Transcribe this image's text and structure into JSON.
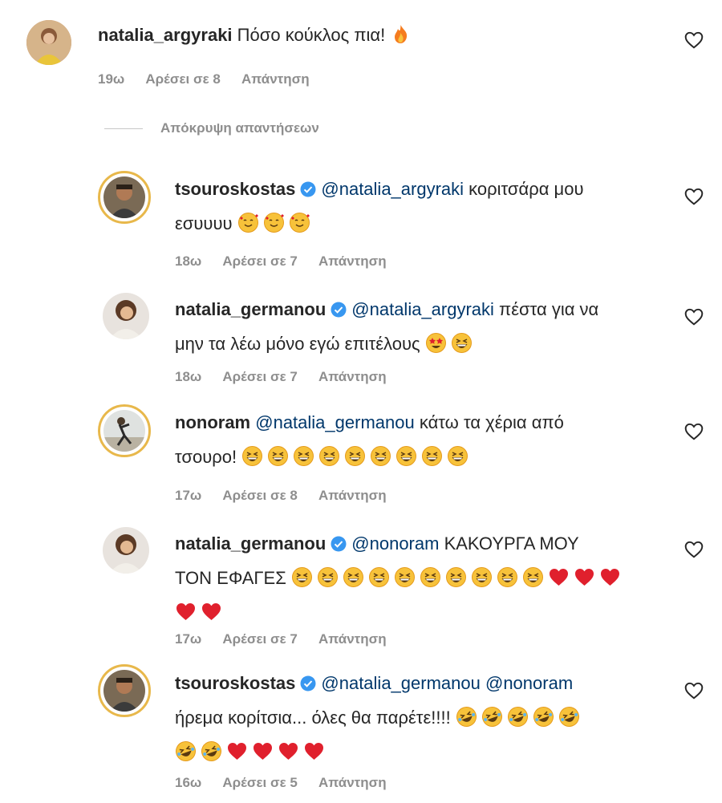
{
  "comments": [
    {
      "username": "natalia_argyraki",
      "verified": false,
      "mentions": [],
      "text_line1": "Πόσο κούκλος πια!",
      "text_line2": "",
      "time": "19ω",
      "likes": "Αρέσει σε 8",
      "reply": "Απάντηση",
      "emoji_line1": [
        "fire"
      ],
      "emoji_line2": [],
      "emoji_line3": []
    },
    {
      "username": "tsouroskostas",
      "verified": true,
      "mention1": "@natalia_argyraki",
      "text_line1": " κοριτσάρα μου",
      "text_line2": "εσυυυυ",
      "time": "18ω",
      "likes": "Αρέσει σε 7",
      "reply": "Απάντηση",
      "emoji_line2": [
        "smiling-hearts",
        "smiling-hearts",
        "smiling-hearts"
      ]
    },
    {
      "username": "natalia_germanou",
      "verified": true,
      "mention1": "@natalia_argyraki",
      "text_line1": " πέστα για να",
      "text_line2": "μην τα λέω μόνο εγώ επιτέλους",
      "time": "18ω",
      "likes": "Αρέσει σε 7",
      "reply": "Απάντηση",
      "emoji_line2": [
        "star-eyes",
        "grin"
      ]
    },
    {
      "username": "nonoram",
      "verified": false,
      "mention1": "@natalia_germanou",
      "text_line1": " κάτω τα χέρια από",
      "text_line2": "τσουρο!",
      "time": "17ω",
      "likes": "Αρέσει σε 8",
      "reply": "Απάντηση",
      "emoji_line2": [
        "grin",
        "grin",
        "grin",
        "grin",
        "grin",
        "grin",
        "grin",
        "grin",
        "grin"
      ]
    },
    {
      "username": "natalia_germanou",
      "verified": true,
      "mention1": "@nonoram",
      "text_line1": " ΚΑΚΟΥΡΓΑ ΜΟΥ",
      "text_line2": "ΤΟΝ ΕΦΑΓΕΣ",
      "time": "17ω",
      "likes": "Αρέσει σε 7",
      "reply": "Απάντηση",
      "emoji_line2": [
        "grin",
        "grin",
        "grin",
        "grin",
        "grin",
        "grin",
        "grin",
        "grin",
        "grin",
        "grin",
        "heart",
        "heart",
        "heart"
      ],
      "emoji_line3": [
        "heart",
        "heart"
      ]
    },
    {
      "username": "tsouroskostas",
      "verified": true,
      "mention1": "@natalia_germanou",
      "mention2": "@nonoram",
      "text_line1": " ",
      "text_line2": "ήρεμα κορίτσια... όλες θα παρέτε!!!!",
      "time": "16ω",
      "likes": "Αρέσει σε 5",
      "reply": "Απάντηση",
      "emoji_line2": [
        "rofl",
        "rofl",
        "rofl",
        "rofl",
        "rofl"
      ],
      "emoji_line3": [
        "rofl",
        "rofl",
        "heart",
        "heart",
        "heart",
        "heart"
      ]
    }
  ],
  "hide_replies": "Απόκρυψη απαντήσεων",
  "colors": {
    "text": "#262626",
    "meta": "#8e8e8e",
    "mention": "#00376b",
    "verified": "#3897f0",
    "story_ring": "#e8b84b",
    "heart_emoji": "#e0202d",
    "emoji_face": "#f7c23a"
  },
  "icons": {
    "like": "heart-outline-icon",
    "verified": "verified-badge-icon"
  }
}
